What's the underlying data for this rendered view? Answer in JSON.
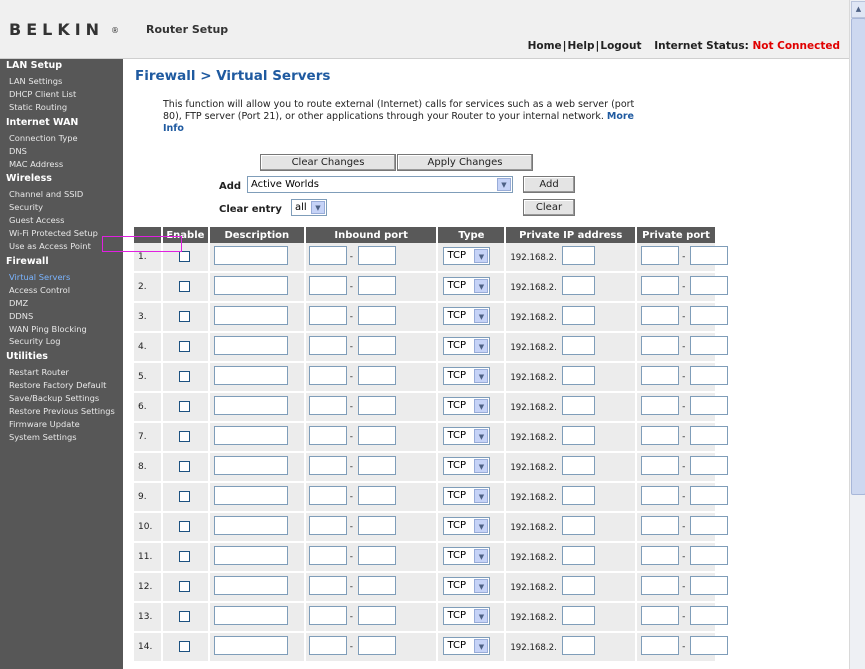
{
  "header": {
    "logo": "BELKIN",
    "logo_mark": "®",
    "title": "Router Setup",
    "links": [
      "Home",
      "Help",
      "Logout"
    ],
    "status_label": "Internet Status:",
    "status_value": "Not Connected",
    "status_color": "#e00000"
  },
  "sidebar": {
    "sections": [
      {
        "title": "LAN Setup",
        "items": [
          "LAN Settings",
          "DHCP Client List",
          "Static Routing"
        ]
      },
      {
        "title": "Internet WAN",
        "items": [
          "Connection Type",
          "DNS",
          "MAC Address"
        ]
      },
      {
        "title": "Wireless",
        "items": [
          "Channel and SSID",
          "Security",
          "Guest Access",
          "Wi-Fi Protected Setup",
          "Use as Access Point"
        ]
      },
      {
        "title": "Firewall",
        "items": [
          "Virtual Servers",
          "Access Control",
          "DMZ",
          "DDNS",
          "WAN Ping Blocking",
          "Security Log"
        ]
      },
      {
        "title": "Utilities",
        "items": [
          "Restart Router",
          "Restore Factory Default",
          "Save/Backup Settings",
          "Restore Previous Settings",
          "Firmware Update",
          "System Settings"
        ]
      }
    ],
    "active_item": "Virtual Servers",
    "active_color": "#7ab4ff"
  },
  "main": {
    "title": "Firewall > Virtual Servers",
    "intro": "This function will allow you to route external (Internet) calls for services such as a web server (port 80), FTP server (Port 21), or other applications through your Router to your internal network.",
    "more_info": "More Info",
    "clear_changes": "Clear Changes",
    "apply_changes": "Apply Changes",
    "add_label": "Add",
    "add_selected": "Active Worlds",
    "add_button": "Add",
    "clear_entry_label": "Clear entry",
    "clear_entry_selected": "all",
    "clear_button": "Clear"
  },
  "table": {
    "headers": [
      "Enable",
      "Description",
      "Inbound port",
      "Type",
      "Private IP address",
      "Private port"
    ],
    "rows": [
      {
        "num": "1.",
        "type": "TCP",
        "ip_prefix": "192.168.2."
      },
      {
        "num": "2.",
        "type": "TCP",
        "ip_prefix": "192.168.2."
      },
      {
        "num": "3.",
        "type": "TCP",
        "ip_prefix": "192.168.2."
      },
      {
        "num": "4.",
        "type": "TCP",
        "ip_prefix": "192.168.2."
      },
      {
        "num": "5.",
        "type": "TCP",
        "ip_prefix": "192.168.2."
      },
      {
        "num": "6.",
        "type": "TCP",
        "ip_prefix": "192.168.2."
      },
      {
        "num": "7.",
        "type": "TCP",
        "ip_prefix": "192.168.2."
      },
      {
        "num": "8.",
        "type": "TCP",
        "ip_prefix": "192.168.2."
      },
      {
        "num": "9.",
        "type": "TCP",
        "ip_prefix": "192.168.2."
      },
      {
        "num": "10.",
        "type": "TCP",
        "ip_prefix": "192.168.2."
      },
      {
        "num": "11.",
        "type": "TCP",
        "ip_prefix": "192.168.2."
      },
      {
        "num": "12.",
        "type": "TCP",
        "ip_prefix": "192.168.2."
      },
      {
        "num": "13.",
        "type": "TCP",
        "ip_prefix": "192.168.2."
      },
      {
        "num": "14.",
        "type": "TCP",
        "ip_prefix": "192.168.2."
      }
    ]
  },
  "colors": {
    "title_blue": "#1f5aa0",
    "sidebar_bg": "#575757",
    "table_header_bg": "#595959",
    "highlight": "#e020e0"
  }
}
